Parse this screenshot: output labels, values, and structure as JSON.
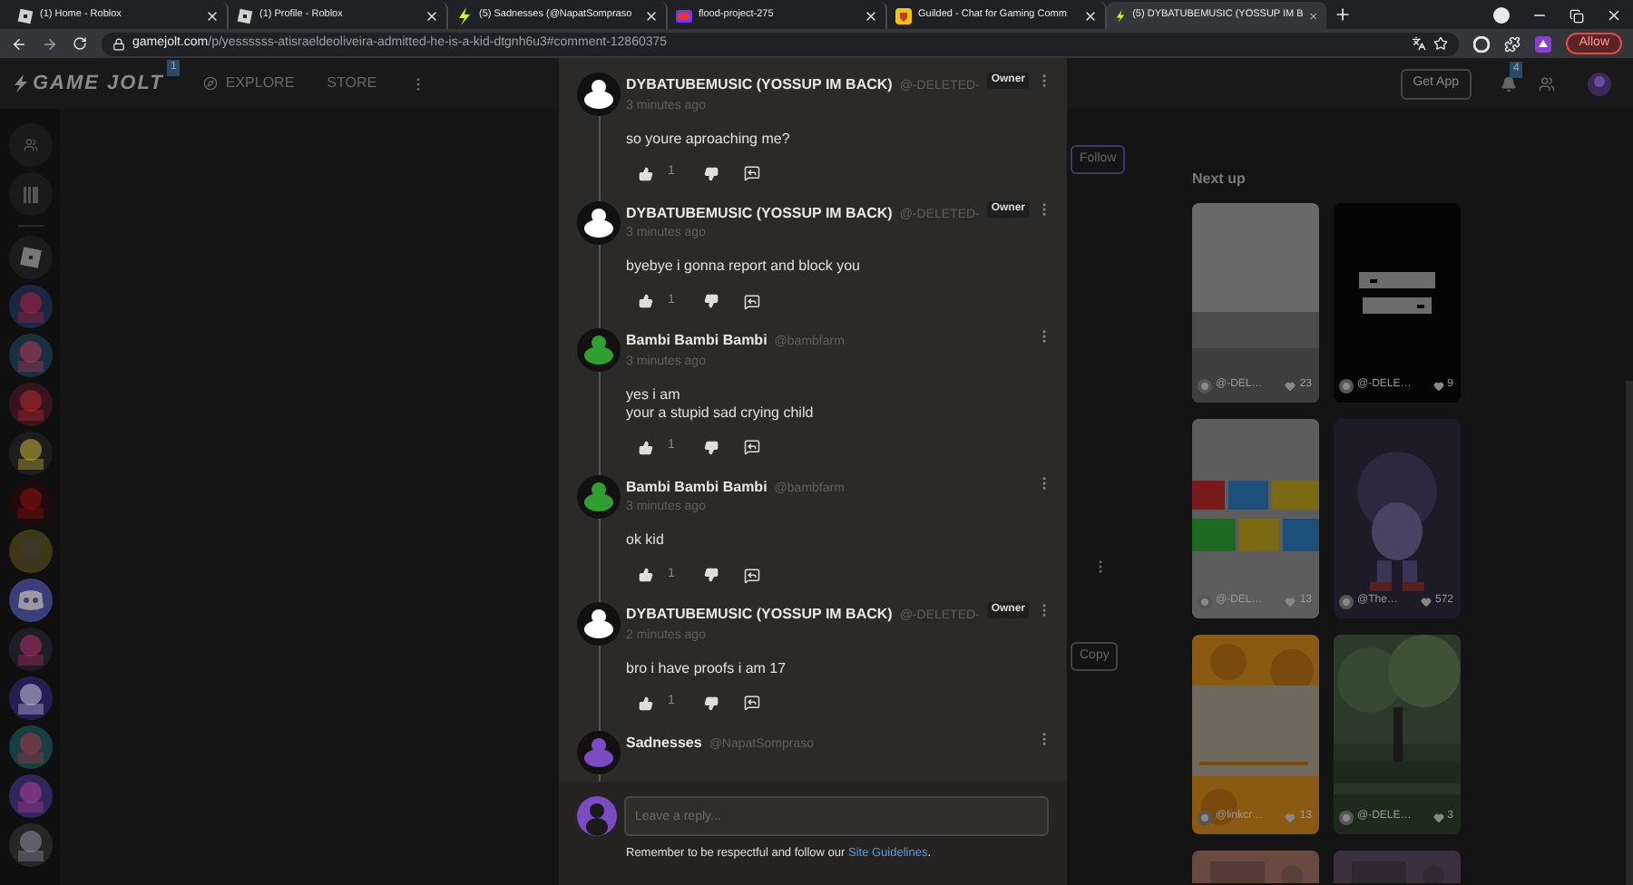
{
  "browser": {
    "tabs": [
      {
        "title": "(1) Home - Roblox",
        "kind": "roblox",
        "selected": false
      },
      {
        "title": "(1) Profile - Roblox",
        "kind": "roblox",
        "selected": false
      },
      {
        "title": "(5) Sadnesses (@NapatSompraso",
        "kind": "gamejolt",
        "selected": false
      },
      {
        "title": "flood-project-275",
        "kind": "flood",
        "selected": false
      },
      {
        "title": "Guilded - Chat for Gaming Comm",
        "kind": "guilded",
        "selected": false
      },
      {
        "title": "(5) DYBATUBEMUSIC (YOSSUP IM B",
        "kind": "gamejolt",
        "selected": true
      }
    ],
    "url_domain": "gamejolt.com",
    "url_path": "/p/yessssss-atisraeldeoliveira-admitted-he-is-a-kid-dtgnh6u3#comment-12860375",
    "allow_button": "Allow"
  },
  "site_header": {
    "logo": "GAME JOLT",
    "logo_badge": "1",
    "nav": [
      "EXPLORE",
      "STORE"
    ],
    "get_app": "Get App",
    "notification_count": "4"
  },
  "page": {
    "follow_button": "Follow",
    "copy_button": "Copy"
  },
  "next_up": {
    "title": "Next up",
    "cards": [
      {
        "user": "@-DEL…",
        "likes": "23",
        "kind": "gray"
      },
      {
        "user": "@-DELE…",
        "likes": "9",
        "kind": "black"
      },
      {
        "user": "@-DEL…",
        "likes": "13",
        "kind": "logo"
      },
      {
        "user": "@The…",
        "likes": "572",
        "kind": "purple"
      },
      {
        "user": "@linkcr…",
        "likes": "13",
        "kind": "orange"
      },
      {
        "user": "@-DELE…",
        "likes": "3",
        "kind": "trees"
      }
    ]
  },
  "comments": [
    {
      "author": "DYBATUBEMUSIC (YOSSUP IM BACK)",
      "handle": "@-DELETED-",
      "badge": "Owner",
      "time": "3 minutes ago",
      "lines": [
        "so youre aproaching me?"
      ],
      "likes": "1",
      "color": "#ffffff"
    },
    {
      "author": "DYBATUBEMUSIC (YOSSUP IM BACK)",
      "handle": "@-DELETED-",
      "badge": "Owner",
      "time": "3 minutes ago",
      "lines": [
        "byebye i gonna report and block you"
      ],
      "likes": "1",
      "color": "#ffffff"
    },
    {
      "author": "Bambi Bambi Bambi",
      "handle": "@bambfarm",
      "time": "3 minutes ago",
      "lines": [
        "yes i am",
        "your a stupid sad crying child"
      ],
      "likes": "1",
      "color": "#2fa02f"
    },
    {
      "author": "Bambi Bambi Bambi",
      "handle": "@bambfarm",
      "time": "3 minutes ago",
      "lines": [
        "ok kid"
      ],
      "likes": "1",
      "color": "#2fa02f"
    },
    {
      "author": "DYBATUBEMUSIC (YOSSUP IM BACK)",
      "handle": "@-DELETED-",
      "badge": "Owner",
      "time": "2 minutes ago",
      "lines": [
        "bro i have proofs i am 17"
      ],
      "likes": "1",
      "color": "#ffffff"
    },
    {
      "author": "Sadnesses",
      "handle": "@NapatSompraso",
      "color": "#7b4bc4"
    }
  ],
  "reply": {
    "placeholder": "Leave a reply...",
    "note": "Remember to be respectful and follow our ",
    "link": "Site Guidelines",
    "note_end": "."
  }
}
